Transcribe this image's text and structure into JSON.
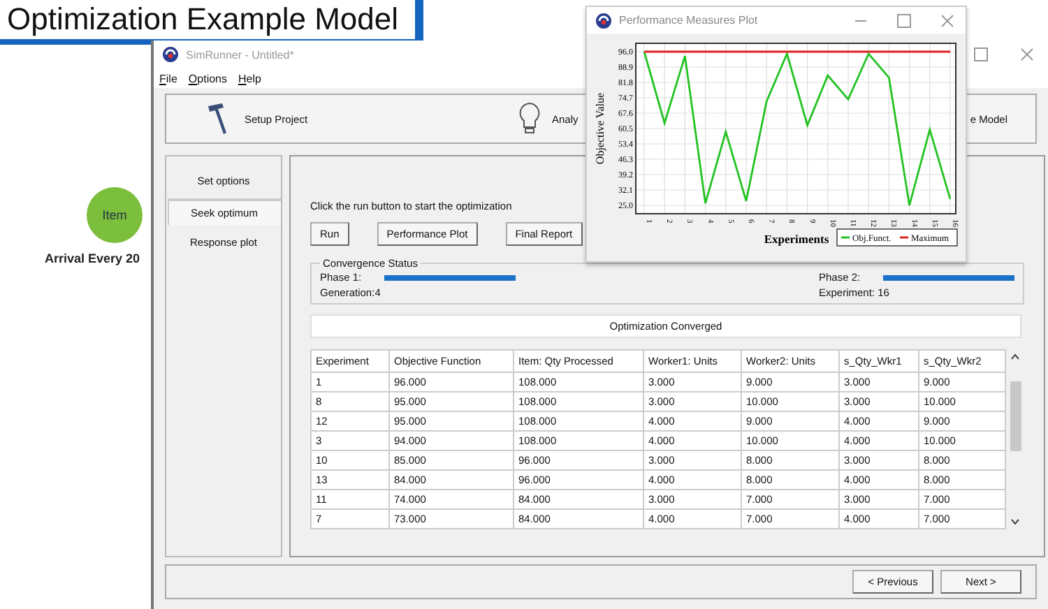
{
  "slide_title": "Optimization Example Model",
  "model": {
    "node_label": "Item",
    "arrival_label": "Arrival Every 20"
  },
  "simrunner": {
    "title": "SimRunner - Untitled*",
    "menu": [
      "File",
      "Options",
      "Help"
    ],
    "toolbar": [
      {
        "label": "Setup Project",
        "kind": "hammer"
      },
      {
        "label": "Analy",
        "kind": "bulb"
      },
      {
        "label": "e Model",
        "kind": "text"
      }
    ],
    "nav": [
      {
        "label": "Set options",
        "selected": false
      },
      {
        "label": "Seek optimum",
        "selected": true
      },
      {
        "label": "Response plot",
        "selected": false
      }
    ],
    "instruction": "Click the run button to start the optimization",
    "buttons": [
      "Run",
      "Performance Plot",
      "Final Report"
    ],
    "convergence": {
      "title": "Convergence Status",
      "phases": [
        {
          "label": "Phase 1:",
          "level": 1,
          "status": "Generation:4"
        },
        {
          "label": "Phase 2:",
          "level": 1,
          "status": "Experiment: 16"
        }
      ]
    },
    "status_message": "Optimization Converged",
    "table": {
      "columns": [
        "Experiment",
        "Objective Function",
        "Item: Qty Processed",
        "Worker1: Units",
        "Worker2: Units",
        "s_Qty_Wkr1",
        "s_Qty_Wkr2"
      ],
      "rows": [
        [
          "1",
          "96.000",
          "108.000",
          "3.000",
          "9.000",
          "3.000",
          "9.000"
        ],
        [
          "8",
          "95.000",
          "108.000",
          "3.000",
          "10.000",
          "3.000",
          "10.000"
        ],
        [
          "12",
          "95.000",
          "108.000",
          "4.000",
          "9.000",
          "4.000",
          "9.000"
        ],
        [
          "3",
          "94.000",
          "108.000",
          "4.000",
          "10.000",
          "4.000",
          "10.000"
        ],
        [
          "10",
          "85.000",
          "96.000",
          "3.000",
          "8.000",
          "3.000",
          "8.000"
        ],
        [
          "13",
          "84.000",
          "96.000",
          "4.000",
          "8.000",
          "4.000",
          "8.000"
        ],
        [
          "11",
          "74.000",
          "84.000",
          "3.000",
          "7.000",
          "3.000",
          "7.000"
        ],
        [
          "7",
          "73.000",
          "84.000",
          "4.000",
          "7.000",
          "4.000",
          "7.000"
        ]
      ]
    },
    "nav_buttons": [
      "< Previous",
      "Next >"
    ]
  },
  "plot_window": {
    "title": "Performance Measures Plot",
    "chart_data": {
      "type": "line",
      "xlabel": "Experiments",
      "ylabel": "Objective Value",
      "categories": [
        "1",
        "2",
        "3",
        "4",
        "5",
        "6",
        "7",
        "8",
        "9",
        "10",
        "11",
        "12",
        "13",
        "14",
        "15",
        "16"
      ],
      "series": [
        {
          "name": "Obj.Funct.",
          "color": "#22c322",
          "values": [
            96,
            63,
            94,
            26,
            59,
            27,
            73,
            95,
            62,
            85,
            74,
            95,
            84,
            25,
            60,
            28
          ]
        },
        {
          "name": "Maximum",
          "color": "#e02020",
          "values": [
            96,
            96,
            96,
            96,
            96,
            96,
            96,
            96,
            96,
            96,
            96,
            96,
            96,
            96,
            96,
            96
          ]
        }
      ],
      "ylim": [
        25,
        96
      ],
      "grid": true,
      "legend": true,
      "yticks": [
        {
          "value": 25,
          "label": "25.0"
        },
        {
          "value": 32.1,
          "label": "32.1"
        },
        {
          "value": 39.2,
          "label": "39.2"
        },
        {
          "value": 46.3,
          "label": "46.3"
        },
        {
          "value": 53.4,
          "label": "53.4"
        },
        {
          "value": 60.5,
          "label": "60.5"
        },
        {
          "value": 67.6,
          "label": "67.6"
        },
        {
          "value": 74.7,
          "label": "74.7"
        },
        {
          "value": 81.8,
          "label": "81.8"
        },
        {
          "value": 88.9,
          "label": "88.9"
        },
        {
          "value": 96,
          "label": "96.0"
        }
      ]
    }
  }
}
